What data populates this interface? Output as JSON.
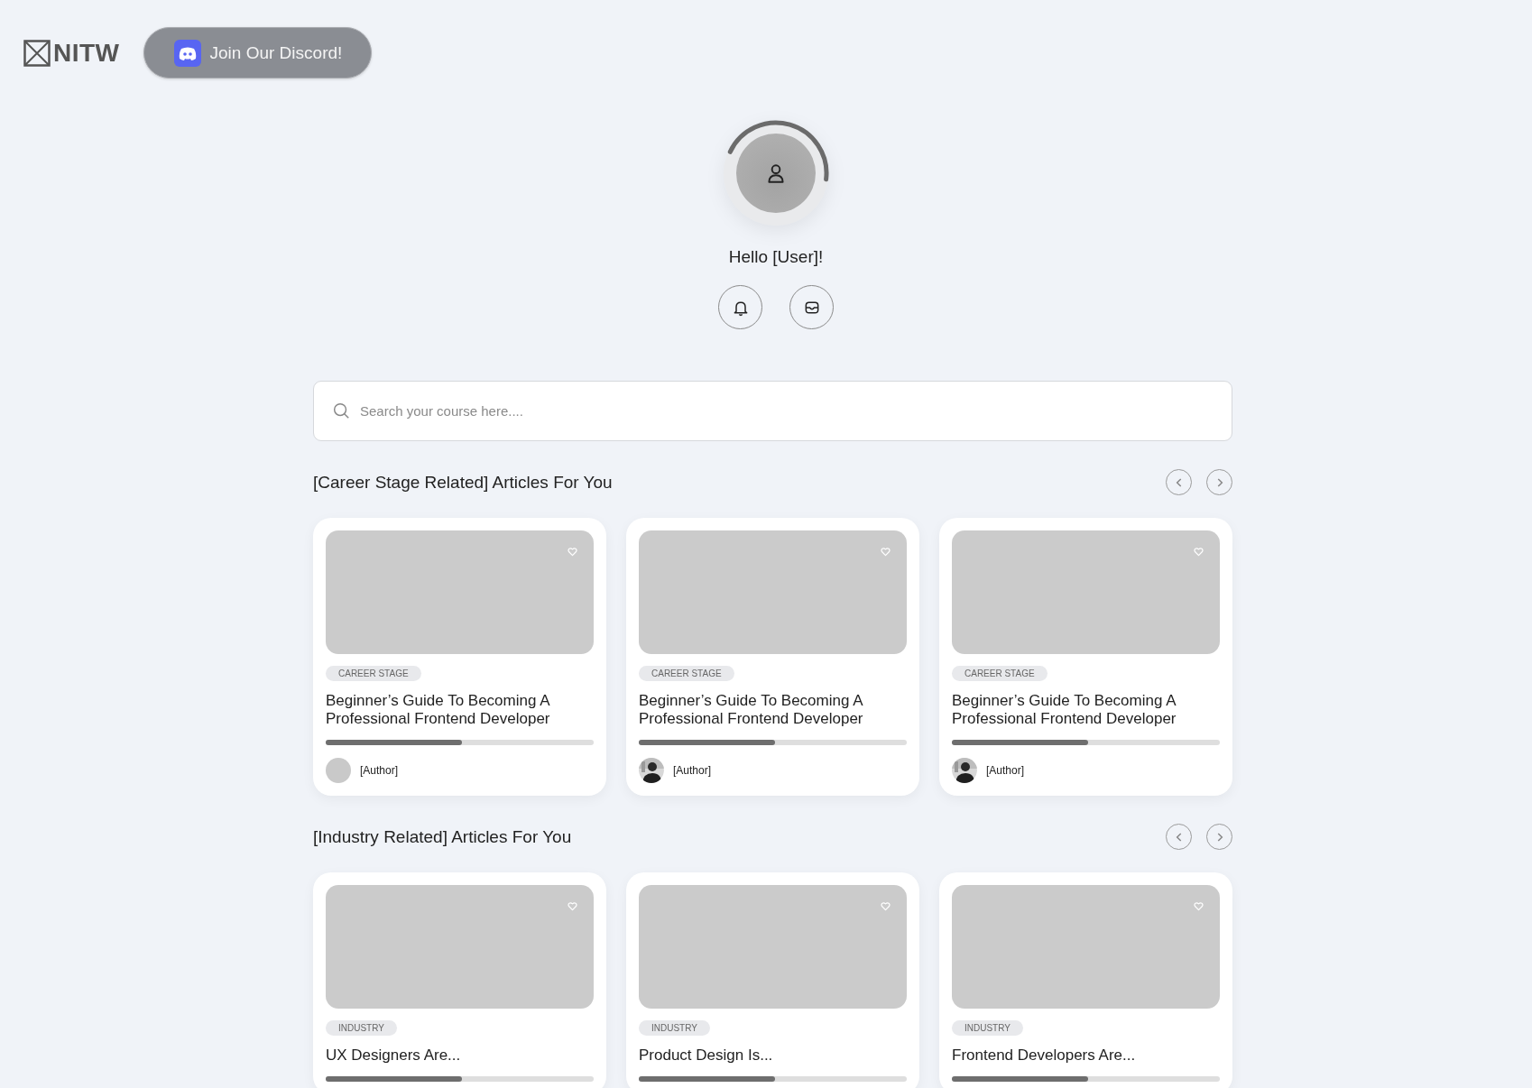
{
  "header": {
    "logo": "NITW",
    "discord_button": "Join Our Discord!"
  },
  "profile": {
    "greeting": "Hello [User]!"
  },
  "search": {
    "placeholder": "Search your course here...."
  },
  "sections": [
    {
      "title": "[Career Stage Related] Articles For You",
      "cards": [
        {
          "tag": "CAREER STAGE",
          "title": "Beginner’s Guide To Becoming A Professional Frontend Developer",
          "level": 0.51,
          "author": {
            "name": "[Author]",
            "kind": "blank"
          }
        },
        {
          "tag": "CAREER STAGE",
          "title": "Beginner’s Guide To Becoming A Professional Frontend Developer",
          "level": 0.51,
          "author": {
            "name": "[Author]"
          }
        },
        {
          "tag": "CAREER STAGE",
          "title": "Beginner’s Guide To Becoming A Professional Frontend Developer",
          "level": 0.51,
          "author": {
            "name": "[Author]"
          }
        }
      ]
    },
    {
      "title": "[Industry Related] Articles For You",
      "cards": [
        {
          "tag": "INDUSTRY",
          "title": "UX Designers Are...",
          "level": 0.51
        },
        {
          "tag": "INDUSTRY",
          "title": "Product Design Is...",
          "level": 0.51
        },
        {
          "tag": "INDUSTRY",
          "title": "Frontend Developers Are...",
          "level": 0.51
        }
      ]
    }
  ]
}
